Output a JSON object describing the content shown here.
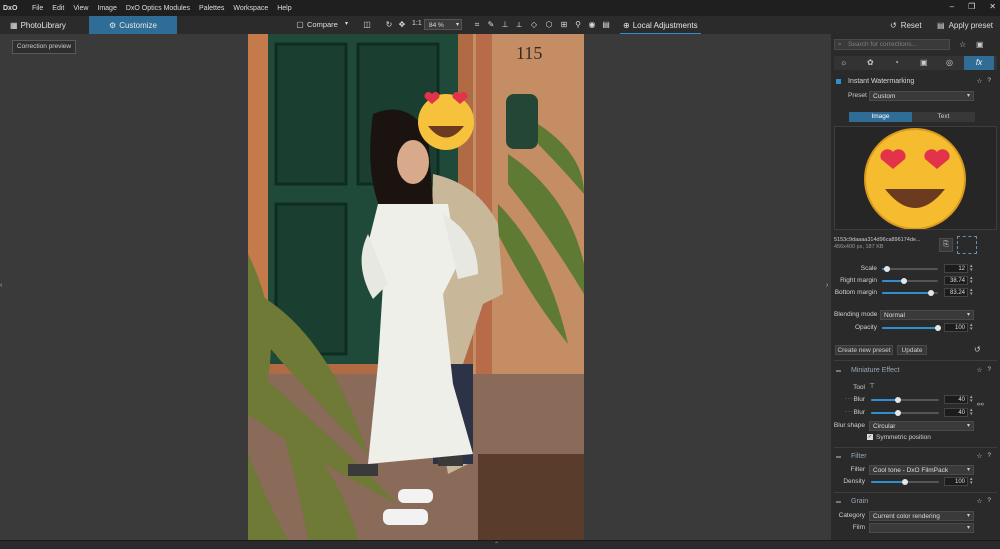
{
  "menu": {
    "logo": "DxO",
    "items": [
      "File",
      "Edit",
      "View",
      "Image",
      "DxO Optics Modules",
      "Palettes",
      "Workspace",
      "Help"
    ]
  },
  "toolbar": {
    "photolibrary": "PhotoLibrary",
    "customize": "Customize",
    "compare": "Compare",
    "one_to_one": "1:1",
    "zoom": "84 %",
    "local_adjustments": "Local Adjustments",
    "reset": "Reset",
    "apply_preset": "Apply preset"
  },
  "viewer": {
    "correction_preview": "Correction preview"
  },
  "panel": {
    "search_placeholder": "Search for corrections...",
    "watermark": {
      "title": "Instant Watermarking",
      "preset_label": "Preset",
      "preset_value": "Custom",
      "tab_image": "Image",
      "tab_text": "Text",
      "file_name": "5153c9daaaa314d96ca896174de...",
      "file_info": "456x400 px, 187 KB",
      "scale_label": "Scale",
      "scale_value": "12",
      "right_margin_label": "Right margin",
      "right_margin_value": "38.74",
      "bottom_margin_label": "Bottom margin",
      "bottom_margin_value": "83.24",
      "blending_label": "Blending mode",
      "blending_value": "Normal",
      "opacity_label": "Opacity",
      "opacity_value": "100",
      "create_preset": "Create new preset",
      "update": "Update"
    },
    "miniature": {
      "title": "Miniature Effect",
      "tool_label": "Tool",
      "blur1_label": "Blur",
      "blur1_value": "40",
      "blur2_label": "Blur",
      "blur2_value": "40",
      "shape_label": "Blur shape",
      "shape_value": "Circular",
      "symmetric": "Symmetric position"
    },
    "filter": {
      "title": "Filter",
      "filter_label": "Filter",
      "filter_value": "Cool tone - DxO FilmPack",
      "density_label": "Density",
      "density_value": "100"
    },
    "grain": {
      "title": "Grain",
      "category_label": "Category",
      "category_value": "Current color rendering",
      "film_label": "Film"
    }
  }
}
